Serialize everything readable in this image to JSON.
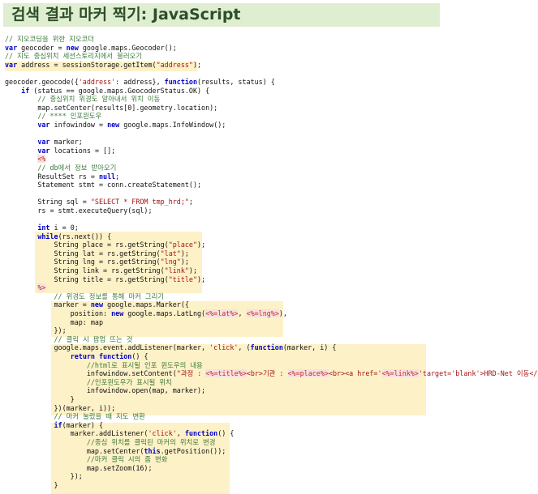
{
  "header": {
    "title": "검색 결과 마커 찍기: JavaScript"
  },
  "colors": {
    "title_background": "#dfeed1",
    "title_text": "#2d4f27",
    "highlight": "#fdf1c7",
    "keyword": "#0000cc",
    "comment": "#3c7a3c",
    "string": "#a31515",
    "jsp_tag": "#c72c2c"
  },
  "code": {
    "language": "JavaScript with JSP scriptlets",
    "lines": [
      [
        [
          "cm",
          "// 지오코딩을 위한 지오코더"
        ]
      ],
      [
        [
          "kw",
          "var"
        ],
        [
          "tx",
          " geocoder = "
        ],
        [
          "kw",
          "new"
        ],
        [
          "tx",
          " google.maps.Geocoder();"
        ]
      ],
      [
        [
          "cm",
          "// 지도 중심위치 세션스토리지에서 불러오기"
        ]
      ],
      [
        [
          "kw",
          "var"
        ],
        [
          "tx",
          " address = sessionStorage.getItem("
        ],
        [
          "str",
          "\"address\""
        ],
        [
          "tx",
          ");"
        ]
      ],
      [],
      [
        [
          "tx",
          "geocoder.geocode({"
        ],
        [
          "str",
          "'address'"
        ],
        [
          "tx",
          ": address}, "
        ],
        [
          "kw",
          "function"
        ],
        [
          "tx",
          "(results, status) {"
        ]
      ],
      [
        [
          "tx",
          "    "
        ],
        [
          "kw",
          "if"
        ],
        [
          "tx",
          " (status == google.maps.GeocoderStatus.OK) {"
        ]
      ],
      [
        [
          "tx",
          "        "
        ],
        [
          "cm",
          "// 중심위치 위경도 알아내서 위치 이동"
        ]
      ],
      [
        [
          "tx",
          "        map.setCenter(results[0].geometry.location);"
        ]
      ],
      [
        [
          "tx",
          "        "
        ],
        [
          "cm",
          "// **** 인포윈도우"
        ]
      ],
      [
        [
          "tx",
          "        "
        ],
        [
          "kw",
          "var"
        ],
        [
          "tx",
          " infowindow = "
        ],
        [
          "kw",
          "new"
        ],
        [
          "tx",
          " google.maps.InfoWindow();"
        ]
      ],
      [],
      [
        [
          "tx",
          "        "
        ],
        [
          "kw",
          "var"
        ],
        [
          "tx",
          " marker;"
        ]
      ],
      [
        [
          "tx",
          "        "
        ],
        [
          "kw",
          "var"
        ],
        [
          "tx",
          " locations = [];"
        ]
      ],
      [
        [
          "tx",
          "        "
        ],
        [
          "jsp",
          "<%"
        ]
      ],
      [
        [
          "tx",
          "        "
        ],
        [
          "cm",
          "// db에서 정보 받아오기"
        ]
      ],
      [
        [
          "tx",
          "        ResultSet rs = "
        ],
        [
          "kw",
          "null"
        ],
        [
          "tx",
          ";"
        ]
      ],
      [
        [
          "tx",
          "        Statement stmt = conn.createStatement();"
        ]
      ],
      [],
      [
        [
          "tx",
          "        String sql = "
        ],
        [
          "str",
          "\"SELECT * FROM tmp_hrd;\""
        ],
        [
          "tx",
          ";"
        ]
      ],
      [
        [
          "tx",
          "        rs = stmt.executeQuery(sql);"
        ]
      ],
      [],
      [
        [
          "tx",
          "        "
        ],
        [
          "kw",
          "int"
        ],
        [
          "tx",
          " i = 0;"
        ]
      ],
      [
        [
          "tx",
          "        "
        ],
        [
          "kw",
          "while"
        ],
        [
          "tx",
          "(rs.next()) {"
        ]
      ],
      [
        [
          "tx",
          "            String place = rs.getString("
        ],
        [
          "str",
          "\"place\""
        ],
        [
          "tx",
          ");"
        ]
      ],
      [
        [
          "tx",
          "            String lat = rs.getString("
        ],
        [
          "str",
          "\"lat\""
        ],
        [
          "tx",
          ");"
        ]
      ],
      [
        [
          "tx",
          "            String lng = rs.getString("
        ],
        [
          "str",
          "\"lng\""
        ],
        [
          "tx",
          ");"
        ]
      ],
      [
        [
          "tx",
          "            String link = rs.getString("
        ],
        [
          "str",
          "\"link\""
        ],
        [
          "tx",
          ");"
        ]
      ],
      [
        [
          "tx",
          "            String title = rs.getString("
        ],
        [
          "str",
          "\"title\""
        ],
        [
          "tx",
          ");"
        ]
      ],
      [
        [
          "tx",
          "        "
        ],
        [
          "jsp",
          "%>"
        ]
      ],
      [
        [
          "tx",
          "            "
        ],
        [
          "cm",
          "// 위경도 정보를 통해 마커 그리기"
        ]
      ],
      [
        [
          "tx",
          "            marker = "
        ],
        [
          "kw",
          "new"
        ],
        [
          "tx",
          " google.maps.Marker({"
        ]
      ],
      [
        [
          "tx",
          "                position: "
        ],
        [
          "kw",
          "new"
        ],
        [
          "tx",
          " google.maps.LatLng("
        ],
        [
          "jsp",
          "<%=lat%>"
        ],
        [
          "tx",
          ", "
        ],
        [
          "jsp",
          "<%=lng%>"
        ],
        [
          "tx",
          "),"
        ]
      ],
      [
        [
          "tx",
          "                map: map"
        ]
      ],
      [
        [
          "tx",
          "            });"
        ]
      ],
      [
        [
          "tx",
          "            "
        ],
        [
          "cm",
          "// 클릭 시 팝업 뜨는 것"
        ]
      ],
      [
        [
          "tx",
          "            google.maps.event.addListener(marker, "
        ],
        [
          "str",
          "'click'"
        ],
        [
          "tx",
          ", ("
        ],
        [
          "kw",
          "function"
        ],
        [
          "tx",
          "(marker, i) {"
        ]
      ],
      [
        [
          "tx",
          "                "
        ],
        [
          "kw",
          "return"
        ],
        [
          "tx",
          " "
        ],
        [
          "kw",
          "function"
        ],
        [
          "tx",
          "() {"
        ]
      ],
      [
        [
          "tx",
          "                    "
        ],
        [
          "cm",
          "//html로 표시될 인포 윈도우의 내용"
        ]
      ],
      [
        [
          "tx",
          "                    infowindow.setContent("
        ],
        [
          "str",
          "\"과정 : "
        ],
        [
          "jsp",
          "<%=title%>"
        ],
        [
          "str",
          "<br>기관 : "
        ],
        [
          "jsp",
          "<%=place%>"
        ],
        [
          "str",
          "<br><a href='"
        ],
        [
          "jsp",
          "<%=link%>"
        ],
        [
          "str",
          "'target='blank'>HRD-Net 이동</a>\""
        ],
        [
          "tx",
          ");"
        ]
      ],
      [
        [
          "tx",
          "                    "
        ],
        [
          "cm",
          "//인포윈도우가 표시될 위치"
        ]
      ],
      [
        [
          "tx",
          "                    infowindow.open(map, marker);"
        ]
      ],
      [
        [
          "tx",
          "                }"
        ]
      ],
      [
        [
          "tx",
          "            })(marker, i));"
        ]
      ],
      [
        [
          "tx",
          "            "
        ],
        [
          "cm",
          "// 마커 눌렀을 때 지도 변환"
        ]
      ],
      [
        [
          "tx",
          "            "
        ],
        [
          "kw",
          "if"
        ],
        [
          "tx",
          "(marker) {"
        ]
      ],
      [
        [
          "tx",
          "                marker.addListener("
        ],
        [
          "str",
          "'click'"
        ],
        [
          "tx",
          ", "
        ],
        [
          "kw",
          "function"
        ],
        [
          "tx",
          "() {"
        ]
      ],
      [
        [
          "tx",
          "                    "
        ],
        [
          "cm",
          "//중심 위치를 클릭된 마커의 위치로 변경"
        ]
      ],
      [
        [
          "tx",
          "                    map.setCenter("
        ],
        [
          "kw",
          "this"
        ],
        [
          "tx",
          ".getPosition());"
        ]
      ],
      [
        [
          "tx",
          "                    "
        ],
        [
          "cm",
          "//마커 클릭 시의 줌 변화"
        ]
      ],
      [
        [
          "tx",
          "                    map.setZoom(16);"
        ]
      ],
      [
        [
          "tx",
          "                });"
        ]
      ],
      [
        [
          "tx",
          "            }"
        ]
      ]
    ]
  }
}
